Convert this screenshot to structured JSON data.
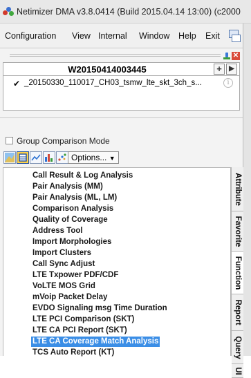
{
  "window": {
    "title": "Netimizer DMA v3.8.0414 (Build 2015.04.14 13:00) (c2000"
  },
  "menu": {
    "items": [
      "Configuration",
      "View",
      "Internal",
      "Window",
      "Help",
      "Exit"
    ]
  },
  "panel": {
    "header_title": "W20150414003445",
    "file_label": "_20150330_110017_CH03_tsmw_lte_skt_3ch_s...",
    "group_comparison_label": "Group Comparison Mode",
    "options_label": "Options..."
  },
  "list": {
    "items": [
      "Call Result & Log Analysis",
      "Pair Analysis (MM)",
      "Pair Analysis (ML, LM)",
      "Comparison Analysis",
      "Quality of Coverage",
      "Address Tool",
      "Import Morphologies",
      "Import Clusters",
      "Call Sync Adjust",
      "LTE Txpower PDF/CDF",
      "VoLTE MOS Grid",
      "mVoip Packet Delay",
      "EVDO Signaling msg Time Duration",
      "LTE PCI Comparison (SKT)",
      "LTE CA PCI Report (SKT)",
      "LTE CA Coverage Match Analysis",
      "TCS Auto Report (KT)"
    ],
    "selected_index": 15
  },
  "vtabs": [
    "Attribute",
    "Favorite",
    "Function",
    "Report",
    "Query",
    "UI"
  ],
  "colors": {
    "selection": "#3b8ee6",
    "active_tool": "#ffd24a"
  },
  "icons": [
    "app-icon",
    "window-tool-icon",
    "pin-icon",
    "close-icon",
    "add-icon",
    "play-icon",
    "info-icon",
    "map-icon",
    "grid-icon",
    "line-chart-icon",
    "bar-chart-icon",
    "scatter-icon",
    "chevron-down-icon"
  ]
}
